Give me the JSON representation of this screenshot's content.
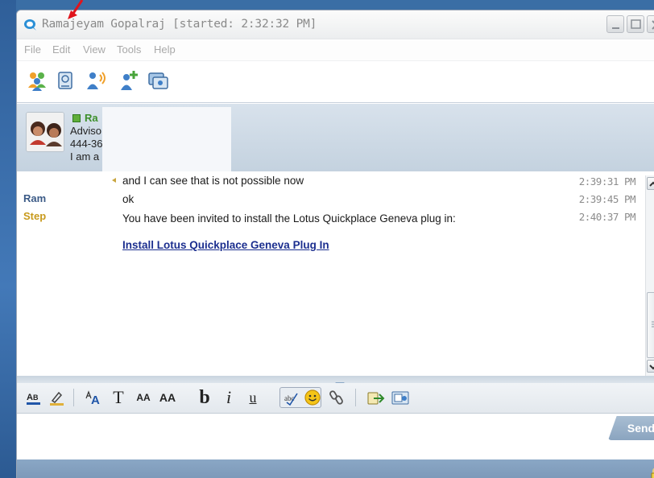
{
  "window": {
    "title": "Ramajeyam Gopalraj [started: 2:32:32 PM]"
  },
  "menu": {
    "items": [
      "File",
      "Edit",
      "View",
      "Tools",
      "Help"
    ]
  },
  "toolbar": {
    "icons": [
      "people-icon",
      "phone-book-icon",
      "speaker-icon",
      "add-person-icon",
      "screen-share-icon"
    ]
  },
  "contact": {
    "name": "Ra",
    "line1": "Adviso",
    "line2": "444-36",
    "line3": "I am a"
  },
  "transcript": {
    "senders": [
      {
        "label": "Ram",
        "color": "#3b5a86"
      },
      {
        "label": "Step",
        "color": "#c89a1c"
      }
    ],
    "messages": [
      {
        "text": "and I can see that is not possible now",
        "time": "2:39:31 PM"
      },
      {
        "text": "ok",
        "time": "2:39:45 PM"
      },
      {
        "text": "You have been invited to install the Lotus Quickplace Geneva plug in:",
        "time": "2:40:37 PM"
      }
    ],
    "link": "Install Lotus Quickplace Geneva Plug In"
  },
  "format_bar": {
    "font_glyph": "A",
    "text_glyph": "T",
    "shrink_glyph": "AA",
    "grow_glyph": "AA",
    "bold": "b",
    "italic": "i",
    "underline": "u"
  },
  "compose": {
    "send_label": "Send"
  },
  "colors": {
    "link": "#1c2f8f",
    "status_online": "#5fae3a",
    "accent": "#8aa7c5"
  }
}
